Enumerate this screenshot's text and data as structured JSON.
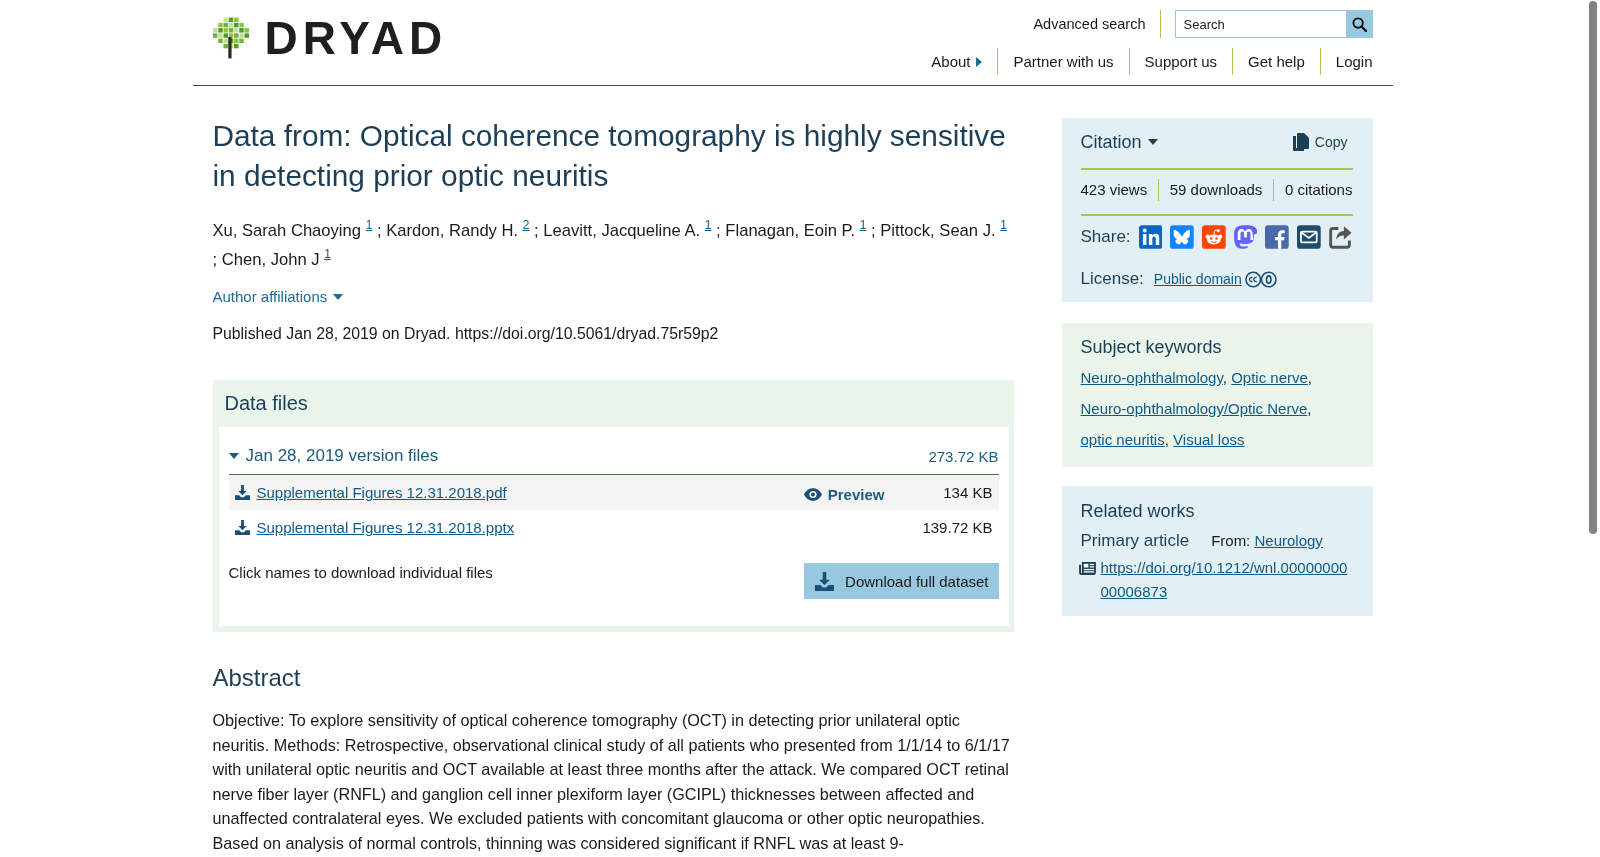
{
  "header": {
    "logo": "DRYAD",
    "advanced_search": "Advanced search",
    "search": {
      "placeholder": "Search"
    },
    "nav": [
      {
        "label": "About",
        "kind": "menu"
      },
      {
        "label": "Partner with us",
        "kind": "link"
      },
      {
        "label": "Support us",
        "kind": "link"
      },
      {
        "label": "Get help",
        "kind": "link"
      },
      {
        "label": "Login",
        "kind": "link"
      }
    ]
  },
  "dataset": {
    "title": "Data from: Optical coherence tomography is highly sensitive in detecting prior optic neuritis",
    "authors": [
      {
        "name": "Xu, Sarah Chaoying",
        "affiliation": "1"
      },
      {
        "name": "Kardon, Randy H.",
        "affiliation": "2"
      },
      {
        "name": "Leavitt, Jacqueline A.",
        "affiliation": "1"
      },
      {
        "name": "Flanagan, Eoin P.",
        "affiliation": "1"
      },
      {
        "name": "Pittock, Sean J.",
        "affiliation": "1"
      },
      {
        "name": "Chen, John J",
        "affiliation": "1"
      }
    ],
    "author_separator": ";",
    "affiliations_toggle": "Author affiliations",
    "published": "Published Jan 28, 2019 on Dryad. https://doi.org/10.5061/dryad.75r59p2"
  },
  "data_files": {
    "heading": "Data files",
    "version": {
      "label": "Jan 28, 2019 version files",
      "size": "273.72 KB",
      "expanded": true,
      "files": [
        {
          "name": "Supplemental Figures 12.31.2018.pdf",
          "preview": "Preview",
          "size": "134 KB"
        },
        {
          "name": "Supplemental Figures 12.31.2018.pptx",
          "size": "139.72 KB"
        }
      ]
    },
    "hint": "Click names to download individual files",
    "download_button": "Download full dataset"
  },
  "abstract": {
    "heading": "Abstract",
    "text": "Objective: To explore sensitivity of optical coherence tomography (OCT) in detecting prior unilateral optic neuritis. Methods: Retrospective, observational clinical study of all patients who presented from 1/1/14 to 6/1/17 with unilateral optic neuritis and OCT available at least three months after the attack. We compared OCT retinal nerve fiber layer (RNFL) and ganglion cell inner plexiform layer (GCIPL) thicknesses between affected and unaffected contralateral eyes. We excluded patients with concomitant glaucoma or other optic neuropathies. Based on analysis of normal controls, thinning was considered significant if RNFL was at least 9-"
  },
  "sidebar": {
    "citation": {
      "label": "Citation",
      "copy_button": "Copy",
      "stats": [
        "423 views",
        "59 downloads",
        "0 citations"
      ],
      "share_label": "Share:",
      "license_label": "License:",
      "license": "Public domain"
    },
    "keywords": {
      "heading": "Subject keywords",
      "items": [
        "Neuro-ophthalmology",
        "Optic nerve",
        "Neuro-ophthalmology/Optic Nerve",
        "optic neuritis",
        "Visual loss"
      ],
      "separator": ","
    },
    "related_works": {
      "heading": "Related works",
      "type": "Primary article",
      "from_label": "From:",
      "journal": "Neurology",
      "doi": "https://doi.org/10.1212/wnl.0000000000006873"
    }
  }
}
